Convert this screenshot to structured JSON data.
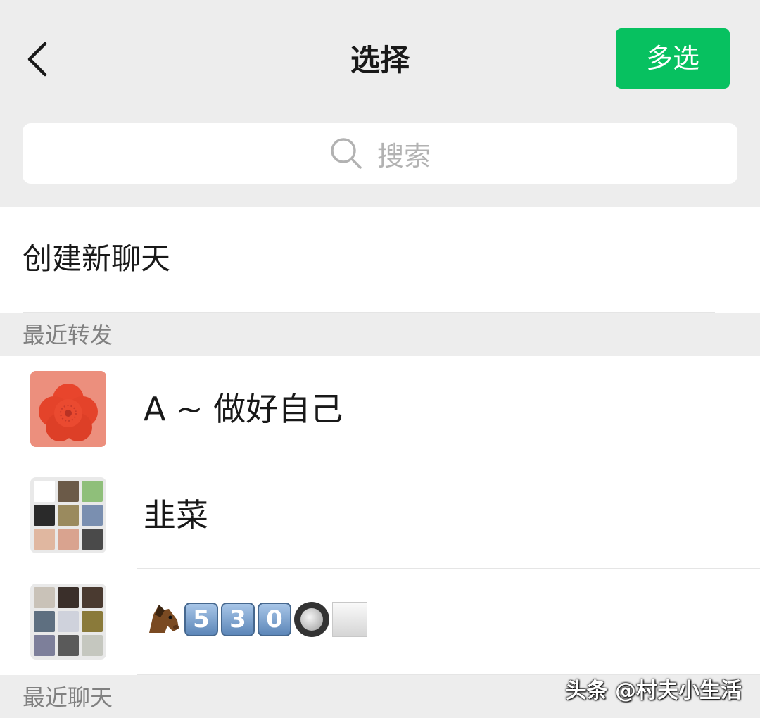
{
  "header": {
    "title": "选择",
    "back_icon": "chevron-left-icon",
    "multi_select_label": "多选",
    "accent_color": "#07c160"
  },
  "search": {
    "placeholder": "搜索",
    "icon": "search-icon"
  },
  "create_chat": {
    "label": "创建新聊天"
  },
  "sections": {
    "recent_forward": "最近转发",
    "recent_chats": "最近聊天"
  },
  "contacts": [
    {
      "name": "A ~ 做好自己",
      "avatar": "red-flower-avatar"
    },
    {
      "name": "韭菜",
      "avatar": "group-grid-avatar"
    },
    {
      "name": "🐴5️⃣3️⃣0️⃣🔘⬜",
      "avatar": "group-grid-avatar"
    }
  ],
  "watermark": "头条 @村夫小生活"
}
